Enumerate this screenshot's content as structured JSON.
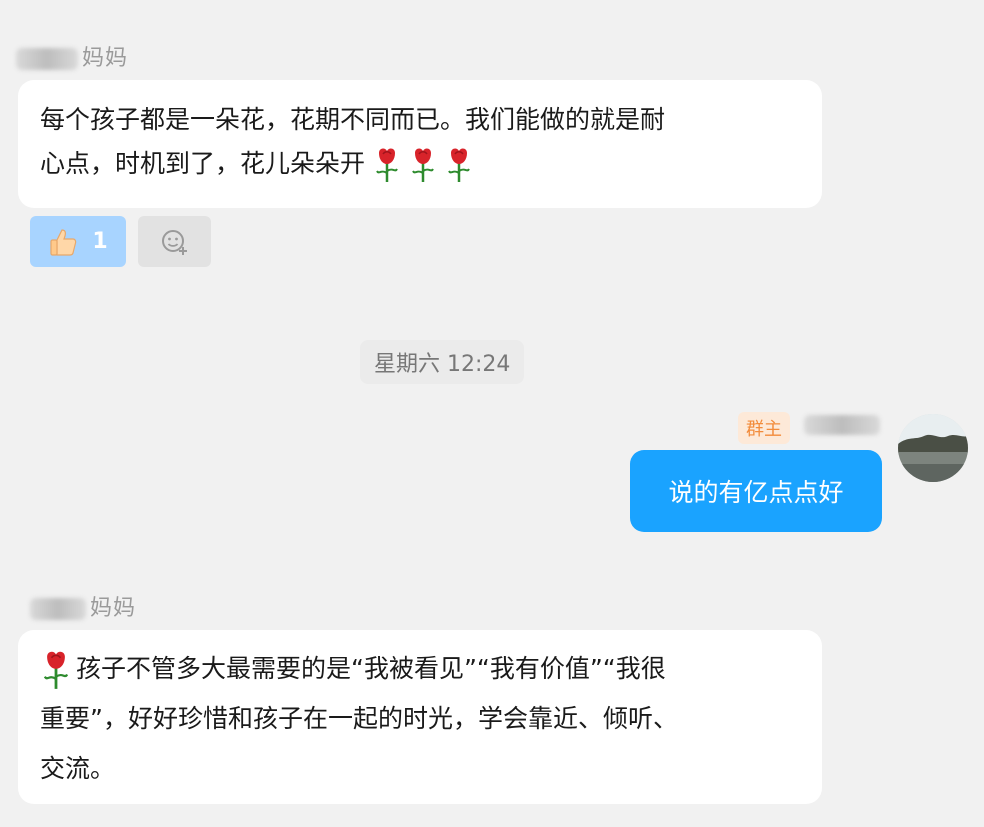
{
  "messages": [
    {
      "sender_suffix": "妈妈",
      "text_line1": "每个孩子都是一朵花，花期不同而已。我们能做的就是耐",
      "text_line2": "心点，时机到了，花儿朵朵开",
      "reactions": {
        "thumbs_count": "1"
      }
    },
    {
      "sender_suffix": "妈妈",
      "text_line1": "孩子不管多大最需要的是“我被看见”“我有价值”“我很",
      "text_line2": "重要”，好好珍惜和孩子在一起的时光，学会靠近、倾听、",
      "text_line3": "交流。"
    }
  ],
  "timestamp": "星期六 12:24",
  "my_message": {
    "role_badge": "群主",
    "text": "说的有亿点点好"
  },
  "icons": [
    "rose-icon",
    "thumbs-up-icon",
    "add-emoji-icon"
  ],
  "colors": {
    "my_bubble": "#1aa3ff",
    "reaction_active": "#a8d4ff",
    "badge_text": "#f28c3c",
    "badge_bg": "#fde9d8"
  }
}
